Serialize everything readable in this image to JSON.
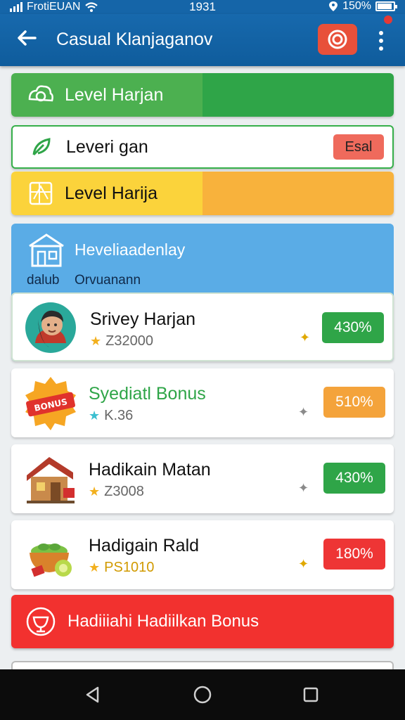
{
  "status_bar": {
    "carrier": "FrotiEUAN",
    "time": "1931",
    "battery": "150%"
  },
  "app_bar": {
    "title": "Casual Klanjaganov"
  },
  "levels": [
    {
      "label": "Level Harjan"
    },
    {
      "label": "Leveri gan",
      "badge": "Esal"
    },
    {
      "label": "Level Harija"
    }
  ],
  "panel": {
    "title": "Heveliaadenlay",
    "sub_a": "dalub",
    "sub_b": "Orvuanann"
  },
  "cards": [
    {
      "title": "Srivey Harjan",
      "value": "Z32000",
      "percent": "430%",
      "color": "#2fa548"
    },
    {
      "title": "Syediatl Bonus",
      "value": "K.36",
      "percent": "510%",
      "color": "#f4a33b"
    },
    {
      "title": "Hadikain Matan",
      "value": "Z3008",
      "percent": "430%",
      "color": "#2fa548"
    },
    {
      "title": "Hadigain Rald",
      "value": "PS1010",
      "percent": "180%",
      "color": "#ee3535"
    }
  ],
  "bonus_bar": {
    "label": "Hadiiiahi Hadiilkan Bonus"
  },
  "icons": [
    "wifi-icon",
    "signal-icon",
    "location-icon",
    "battery-icon",
    "back-arrow-icon",
    "target-icon",
    "more-vert-icon",
    "hub-icon",
    "leaf-icon",
    "map-icon",
    "house-icon",
    "avatar-icon",
    "badge-icon",
    "gift-icon",
    "nav-back-icon",
    "nav-home-icon",
    "nav-recents-icon"
  ]
}
